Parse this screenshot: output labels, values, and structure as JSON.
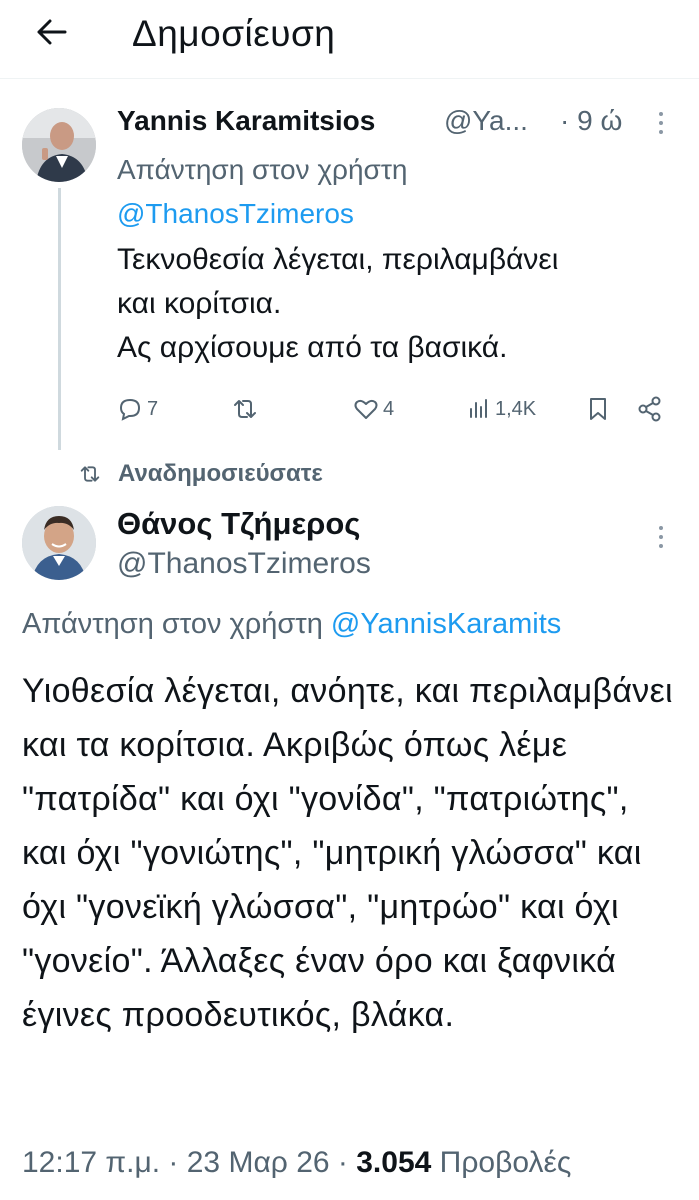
{
  "header": {
    "title": "Δημοσίευση",
    "back_icon": "arrow-left-icon"
  },
  "reply_tweet": {
    "author_name": "Yannis Karamitsios",
    "handle": "@Ya...",
    "time": "· 9 ώ",
    "replying_prefix": "Απάντηση στον χρήστη",
    "replying_to": "@ThanosTzimeros",
    "text": "Τεκνοθεσία λέγεται, περιλαμβάνει\nκαι κορίτσια.\nΑς αρχίσουμε από τα βασικά.",
    "replies": "7",
    "retweets": "",
    "likes": "4",
    "views": "1,4K"
  },
  "retweet_indicator": {
    "label": "Αναδημοσιεύσατε",
    "icon": "retweet-icon"
  },
  "main_tweet": {
    "author_name": "Θάνος Τζήμερος",
    "handle": "@ThanosTzimeros",
    "replying_prefix": "Απάντηση στον χρήστη",
    "replying_to": "@YannisKaramits",
    "text": "Υιοθεσία λέγεται, ανόητε, και περιλαμβάνει και τα κορίτσια. Ακριβώς όπως λέμε \"πατρίδα\" και όχι \"γονίδα\", \"πατριώτης\", και όχι \"γονιώτης\", \"μητρική γλώσσα\" και όχι \"γονεϊκή γλώσσα\", \"μητρώο\" και όχι \"γονείο\". Άλλαξες έναν όρο και ξαφνικά έγινες προοδευτικός, βλάκα.",
    "time": "12:17 π.μ.",
    "date": "23 Μαρ 26",
    "views_count": "3.054",
    "views_label": "Προβολές"
  },
  "colors": {
    "text": "#0f1419",
    "secondary": "#536471",
    "link": "#1d9bf0",
    "divider": "#eff3f4"
  }
}
